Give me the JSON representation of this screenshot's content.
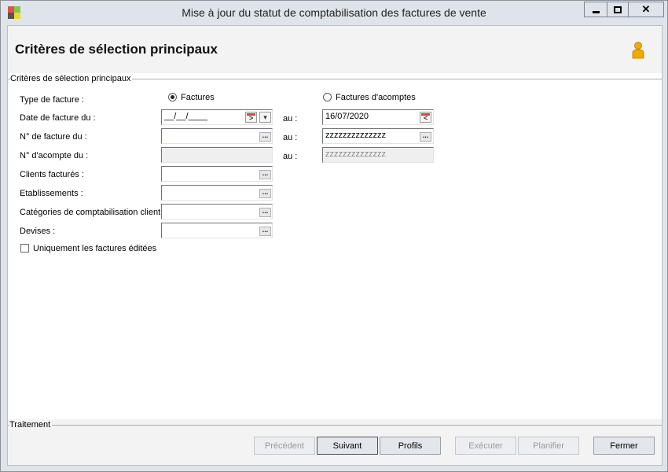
{
  "window": {
    "title": "Mise à jour du statut de comptabilisation des factures de vente"
  },
  "header": {
    "title": "Critères de sélection principaux",
    "user_icon": "user-icon"
  },
  "group_main": {
    "label": "Critères de sélection principaux"
  },
  "form": {
    "type_facture_label": "Type de facture :",
    "radio_factures": "Factures",
    "radio_acomptes": "Factures d'acomptes",
    "radio_selected": "Factures",
    "date_label": "Date de facture du :",
    "date_from_value": "__/__/____",
    "date_to_value": "16/07/2020",
    "num_facture_label": "N° de facture du :",
    "num_facture_from": "",
    "num_facture_to": "zzzzzzzzzzzzzz",
    "num_acompte_label": "N° d'acompte du :",
    "num_acompte_from": "",
    "num_acompte_to": "zzzzzzzzzzzzzz",
    "au_label": "au :",
    "clients_label": "Clients facturés :",
    "clients_value": "",
    "etablissements_label": "Etablissements :",
    "etablissements_value": "",
    "categories_label": "Catégories de comptabilisation client :",
    "categories_value": "",
    "devises_label": "Devises :",
    "devises_value": "",
    "ellipsis_glyph": "...",
    "uniquement_label": "Uniquement les factures éditées",
    "uniquement_checked": false
  },
  "group_traitement": {
    "label": "Traitement"
  },
  "buttons": {
    "precedent": {
      "label": "Précédent",
      "enabled": false
    },
    "suivant": {
      "label": "Suivant",
      "enabled": true
    },
    "profils": {
      "label": "Profils",
      "enabled": true
    },
    "executer": {
      "label": "Exécuter",
      "enabled": false
    },
    "planifier": {
      "label": "Planifier",
      "enabled": false
    },
    "fermer": {
      "label": "Fermer",
      "enabled": true
    }
  },
  "colors": {
    "window_bg": "#dfe4ea",
    "header_bg": "#f3f3f3",
    "user_icon": "#f2a900",
    "calendar_accent": "#d04a3a"
  }
}
